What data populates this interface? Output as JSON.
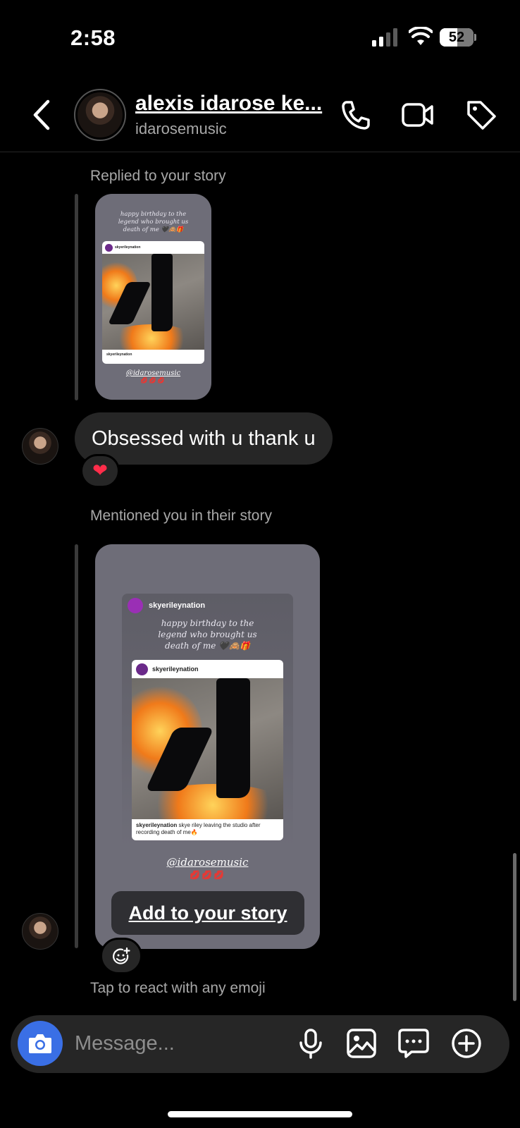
{
  "status_bar": {
    "time": "2:58",
    "battery_percent": "52",
    "battery_level": 0.52
  },
  "header": {
    "display_name": "alexis idarose ke...",
    "username": "idarosemusic",
    "icons": [
      "back-arrow-icon",
      "phone-icon",
      "video-camera-icon",
      "tag-icon"
    ]
  },
  "thread": {
    "replied_label": "Replied to your story",
    "message_text": "Obsessed with u thank u",
    "message_reaction": "❤",
    "mentioned_label": "Mentioned you in their story",
    "mention_story": {
      "username": "skyerileynation",
      "caption_line1": "happy birthday to the",
      "caption_line2": "legend who brought us",
      "caption_line3": "death of me 🖤🙈🎁",
      "post_username": "skyerileynation",
      "post_caption_user": "skyerileynation",
      "post_caption_text": "skye riley leaving the studio after recording death of me🔥",
      "mention_tag": "@idarosemusic",
      "lips": "💋💋💋"
    },
    "add_to_story_label": "Add to your story",
    "react_hint": "Tap to react with any emoji"
  },
  "composer": {
    "placeholder": "Message...",
    "icons": [
      "camera-icon",
      "microphone-icon",
      "gallery-icon",
      "sticker-chat-icon",
      "add-icon"
    ]
  },
  "colors": {
    "background": "#000000",
    "bubble": "#262626",
    "camera_button": "#3a6fe5",
    "story_card": "#6e6d78",
    "secondary_text": "#a8a8a8"
  }
}
